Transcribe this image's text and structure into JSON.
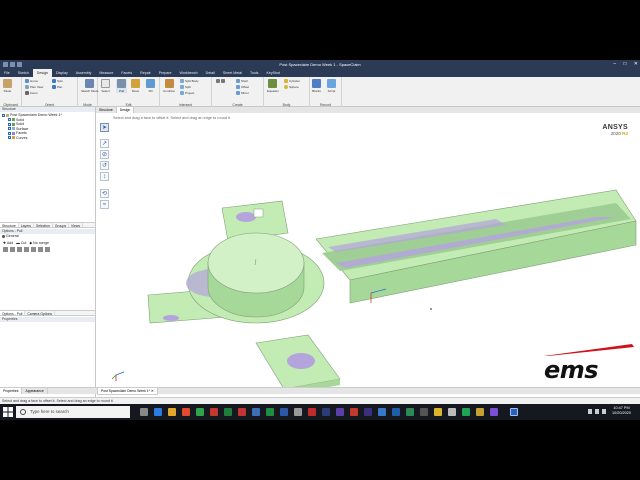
{
  "window": {
    "title": "Post Spaceclaim Demo Week 1 - SpaceClaim",
    "controls": [
      "–",
      "□",
      "✕"
    ]
  },
  "menu_tabs": [
    "File",
    "Sketch",
    "Design",
    "Display",
    "Assembly",
    "Measure",
    "Facets",
    "Repair",
    "Prepare",
    "Workbench",
    "Detail",
    "Sheet Metal",
    "Tools",
    "KeyShot"
  ],
  "active_tab": "Design",
  "ribbon": {
    "clipboard": {
      "label": "Clipboard",
      "paste": "Paste"
    },
    "orient": {
      "label": "Orient",
      "items": [
        "Home",
        "Plan View",
        "Zoom",
        "Spin",
        "Pan"
      ]
    },
    "mode": {
      "label": "Mode",
      "items": [
        "Sketch Mode"
      ]
    },
    "edit": {
      "label": "Edit",
      "items": [
        "Select",
        "Pull",
        "Move",
        "Fill"
      ]
    },
    "intersect": {
      "label": "Intersect",
      "items": [
        "Combine",
        "Split Body",
        "Split",
        "Project"
      ]
    },
    "create": {
      "label": "Create",
      "items": [
        "Shell",
        "Offset",
        "Mirror"
      ]
    },
    "body": {
      "label": "Body",
      "items": [
        "Equation",
        "Cylinder",
        "Sphere"
      ]
    },
    "record": {
      "label": "Record",
      "items": [
        "Blocks",
        "Script"
      ]
    }
  },
  "structure": {
    "header": "Structure",
    "root": "Post Spaceclaim Demo Week 1*",
    "items": [
      "Solid",
      "Solid",
      "Surface",
      "Facets",
      "Curves"
    ],
    "tabs": [
      "Structure",
      "Layers",
      "Selection",
      "Groups",
      "Views"
    ]
  },
  "options": {
    "header": "Options - Pull",
    "general": "General",
    "add": "Add",
    "cut": "Cut",
    "no_merge": "No merge",
    "tabs": [
      "Options - Pull",
      "Camera Options"
    ]
  },
  "properties": {
    "header": "Properties"
  },
  "doc_tabs": [
    "Structure",
    "Design"
  ],
  "viewport": {
    "hint": "Select and drag a face to offset it. Select and drag an edge to round it.",
    "brand": "ANSYS",
    "version": "2020",
    "version_r": "R2"
  },
  "bottom_tabs": [
    "Properties",
    "Appearance"
  ],
  "document_tab": "Post Spaceclaim Demo Week 1*",
  "status": "Select and drag a face to offset it. Select and drag an edge to round it.",
  "taskbar": {
    "search_placeholder": "Type here to search",
    "time": "10:47 PM",
    "date": "10/20/2020"
  },
  "overlay_logo": "ems",
  "colors": {
    "part_green": "#c3ebb4",
    "part_shade": "#9fcf94",
    "part_defect": "#b4a4dc",
    "titlebar": "#2b3a55",
    "ems_red": "#d0121b"
  }
}
